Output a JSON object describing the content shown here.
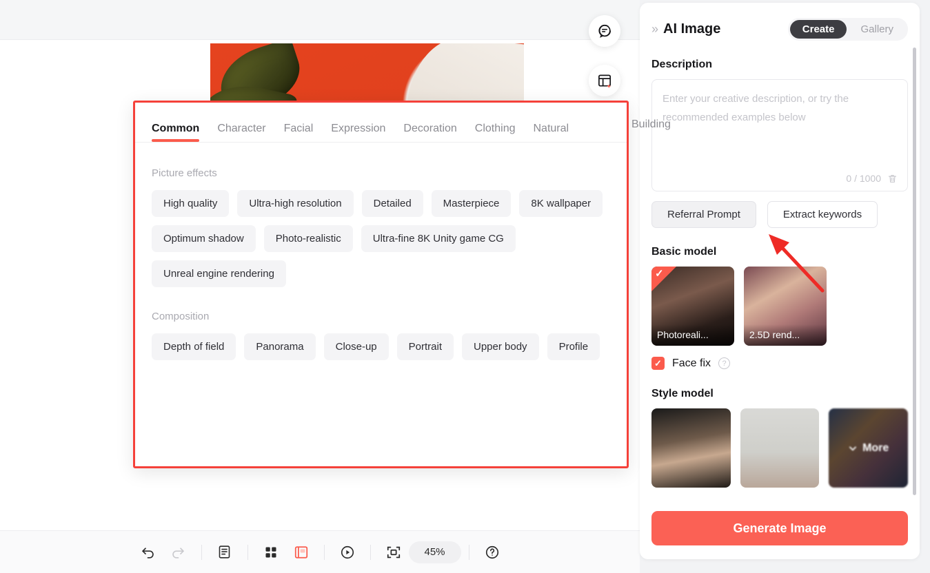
{
  "canvas": {
    "image_alt": "green leaf on red background with white vase"
  },
  "floating_buttons": [
    {
      "name": "comment-icon",
      "label": "Comment"
    },
    {
      "name": "template-sparkle-icon",
      "label": "Templates"
    }
  ],
  "bottom_toolbar": {
    "undo_label": "Undo",
    "redo_label": "Redo",
    "notes_label": "Notes",
    "grid_label": "Grid view",
    "layout_label": "Layout",
    "play_label": "Preview",
    "fit_label": "Fit to screen",
    "zoom_level": "45%",
    "help_label": "Help"
  },
  "tag_panel": {
    "tabs": [
      {
        "label": "Common",
        "active": true
      },
      {
        "label": "Character",
        "active": false
      },
      {
        "label": "Facial",
        "active": false
      },
      {
        "label": "Expression",
        "active": false
      },
      {
        "label": "Decoration",
        "active": false
      },
      {
        "label": "Clothing",
        "active": false
      },
      {
        "label": "Natural",
        "active": false
      }
    ],
    "overflow_tab": "Building",
    "groups": [
      {
        "title": "Picture effects",
        "chips": [
          "High quality",
          "Ultra-high resolution",
          "Detailed",
          "Masterpiece",
          "8K wallpaper",
          "Optimum shadow",
          "Photo-realistic",
          "Ultra-fine 8K Unity game CG",
          "Unreal engine rendering"
        ]
      },
      {
        "title": "Composition",
        "chips": [
          "Depth of field",
          "Panorama",
          "Close-up",
          "Portrait",
          "Upper body",
          "Profile"
        ]
      }
    ]
  },
  "right_panel": {
    "title": "AI Image",
    "collapse_icon": "»",
    "segments": [
      {
        "label": "Create",
        "active": true
      },
      {
        "label": "Gallery",
        "active": false
      }
    ],
    "description": {
      "label": "Description",
      "value": "",
      "placeholder": "Enter your creative description, or try the recommended examples below",
      "counter": "0 / 1000",
      "clear_icon": "trash-icon"
    },
    "actions": {
      "referral_prompt": "Referral Prompt",
      "extract_keywords": "Extract keywords"
    },
    "basic_model": {
      "label": "Basic model",
      "items": [
        {
          "label": "Photoreali...",
          "selected": true
        },
        {
          "label": "2.5D rend...",
          "selected": false
        }
      ],
      "face_fix": {
        "label": "Face fix",
        "checked": true,
        "help_icon": "question-icon"
      }
    },
    "style_model": {
      "label": "Style model",
      "items": [
        {
          "label": "",
          "kind": "portrait"
        },
        {
          "label": "",
          "kind": "vase"
        },
        {
          "label": "More",
          "kind": "more"
        }
      ]
    },
    "generate_button": "Generate Image"
  },
  "annotation": {
    "highlight_color": "#f5413a",
    "arrow_color": "#ee2b26",
    "arrow_target": "Referral Prompt"
  }
}
